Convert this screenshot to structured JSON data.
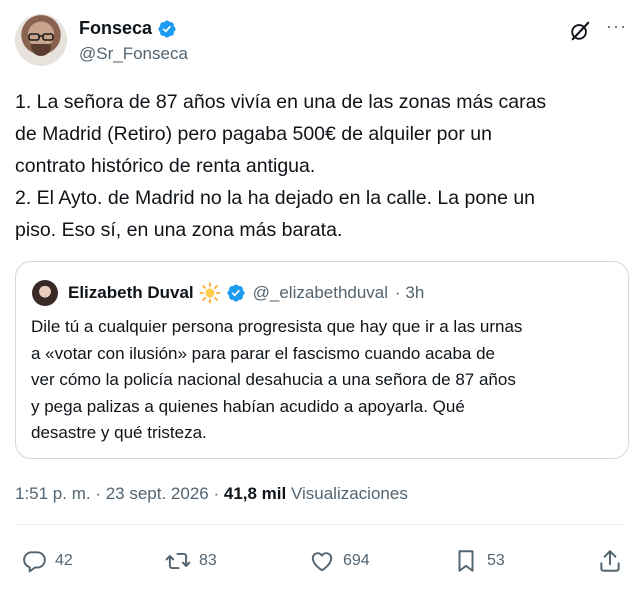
{
  "author": {
    "name": "Fonseca",
    "handle": "@Sr_Fonseca"
  },
  "tweet": {
    "lines": [
      "1. La señora de 87 años vivía en una de las zonas más caras",
      "de Madrid (Retiro) pero pagaba 500€ de alquiler por un",
      "contrato histórico de renta antigua.",
      "2. El Ayto. de Madrid no la ha dejado en la calle. La pone un",
      "piso. Eso sí, en una zona más barata."
    ]
  },
  "quote": {
    "name": "Elizabeth Duval",
    "handle": "@_elizabethduval",
    "time": "· 3h",
    "lines": [
      "Dile tú a cualquier persona progresista que hay que ir a las urnas",
      "a «votar con ilusión» para parar el fascismo cuando acaba de",
      "ver cómo la policía nacional desahucia a una señora de 87 años",
      "y pega palizas a quienes habían acudido a apoyarla. Qué",
      "desastre y qué tristeza."
    ]
  },
  "meta": {
    "time": "1:51 p. m.",
    "sep1": " · ",
    "date": "23 sept. 2026",
    "sep2": " · ",
    "views": "41,8 mil",
    "views_label": " Visualizaciones"
  },
  "actions": {
    "replies": "42",
    "reposts": "83",
    "likes": "694",
    "bookmarks": "53"
  },
  "colors": {
    "verified": "#1d9bf0",
    "text": "#0f1419",
    "secondary": "#536471",
    "border": "#cfd9de"
  },
  "icons": [
    "verified-badge-icon",
    "grok-icon",
    "more-icon",
    "sun-emoji-icon",
    "reply-icon",
    "repost-icon",
    "like-icon",
    "bookmark-icon",
    "share-icon"
  ]
}
